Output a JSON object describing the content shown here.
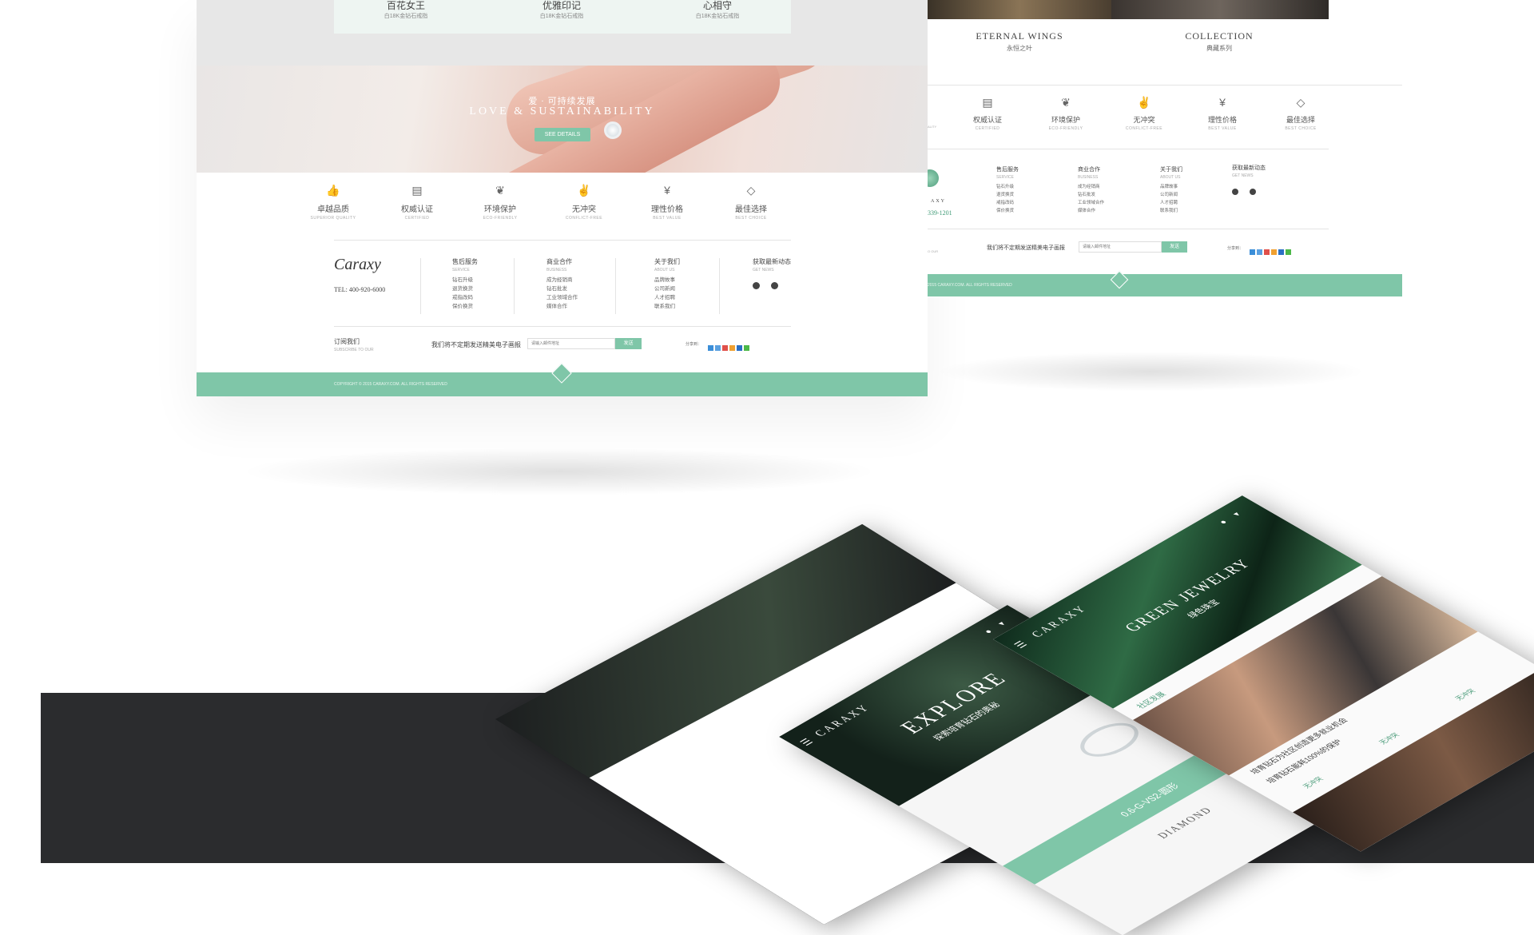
{
  "left_page": {
    "products": [
      {
        "name": "百花女王",
        "sub": "白18K金钻石戒指"
      },
      {
        "name": "优雅印记",
        "sub": "白18K金钻石戒指"
      },
      {
        "name": "心相守",
        "sub": "白18K金钻石戒指"
      }
    ],
    "hero": {
      "subtitle": "爱 · 可持续发展",
      "title": "LOVE & SUSTAINABILITY",
      "button": "SEE DETAILS"
    },
    "features": [
      {
        "icon": "thumbs-up-icon",
        "glyph": "👍",
        "label": "卓越品质",
        "en": "SUPERIOR QUALITY"
      },
      {
        "icon": "certificate-icon",
        "glyph": "▤",
        "label": "权威认证",
        "en": "CERTIFIED"
      },
      {
        "icon": "leaf-icon",
        "glyph": "❦",
        "label": "环境保护",
        "en": "ECO-FRIENDLY"
      },
      {
        "icon": "dove-icon",
        "glyph": "✌",
        "label": "无冲突",
        "en": "CONFLICT-FREE"
      },
      {
        "icon": "yen-icon",
        "glyph": "¥",
        "label": "理性价格",
        "en": "BEST VALUE"
      },
      {
        "icon": "diamond-icon",
        "glyph": "◇",
        "label": "最佳选择",
        "en": "BEST CHOICE"
      }
    ],
    "logo": "Caraxy",
    "tel": "TEL: 400-920-6000",
    "footer_cols": [
      {
        "title": "售后服务",
        "en": "SERVICE",
        "links": [
          "钻石升级",
          "退货换货",
          "戒指改码",
          "保价换货"
        ]
      },
      {
        "title": "商业合作",
        "en": "BUSINESS",
        "links": [
          "成为经销商",
          "钻石批发",
          "工业领域合作",
          "媒体合作"
        ]
      },
      {
        "title": "关于我们",
        "en": "ABOUT US",
        "links": [
          "品牌故事",
          "公司新闻",
          "人才招聘",
          "联系我们"
        ]
      },
      {
        "title": "获取最新动态",
        "en": "GET NEWS",
        "links": []
      }
    ],
    "subscribe": {
      "title": "订阅我们",
      "en": "SUBSCRIBE TO OUR",
      "text": "我们将不定期发送精美电子画报",
      "placeholder": "请输入邮件地址",
      "button": "发送",
      "share_label": "分享到："
    },
    "copyright": "COPYRIGHT © 2015 CARAXY.COM.  ALL RIGHTS RESERVED"
  },
  "right_page": {
    "collections": [
      {
        "title": "ETERNAL WINGS",
        "sub": "永恒之叶"
      },
      {
        "title": "COLLECTION",
        "sub": "典藏系列"
      }
    ],
    "features": [
      {
        "label": "权威认证",
        "en": "CERTIFIED",
        "glyph": "▤",
        "icon": "certificate-icon"
      },
      {
        "label": "环境保护",
        "en": "ECO-FRIENDLY",
        "glyph": "❦",
        "icon": "leaf-icon"
      },
      {
        "label": "无冲突",
        "en": "CONFLICT-FREE",
        "glyph": "✌",
        "icon": "dove-icon"
      },
      {
        "label": "理性价格",
        "en": "BEST VALUE",
        "glyph": "¥",
        "icon": "yen-icon"
      },
      {
        "label": "最佳选择",
        "en": "BEST CHOICE",
        "glyph": "◇",
        "icon": "diamond-icon"
      }
    ],
    "cut_feature_en": "ALITY",
    "logo_word": "AXY",
    "tel_partial": "339-1201",
    "subscribe_partial": "O OUR",
    "footer_cols": [
      {
        "title": "售后服务",
        "en": "SERVICE",
        "links": [
          "钻石升级",
          "退货换货",
          "戒指改码",
          "保价换货"
        ]
      },
      {
        "title": "商业合作",
        "en": "BUSINESS",
        "links": [
          "成为经销商",
          "钻石批发",
          "工业领域合作",
          "媒体合作"
        ]
      },
      {
        "title": "关于我们",
        "en": "ABOUT US",
        "links": [
          "品牌故事",
          "公司新闻",
          "人才招聘",
          "联系我们"
        ]
      },
      {
        "title": "获取最新动态",
        "en": "GET NEWS",
        "links": []
      }
    ],
    "subscribe_text": "我们将不定期发送精美电子画报",
    "placeholder": "请输入邮件地址",
    "button": "发送",
    "share_label": "分享到：",
    "copyright": "2015 CARAXY.COM.  ALL RIGHTS RESERVED"
  },
  "phones": {
    "brand": "CARAXY",
    "phone1_title": "EXPLORE",
    "phone1_sub": "探索培育钻石的奥秘",
    "phone1_strip": "0.6-G-VS2-圆形",
    "phone1_strip2": "DIAMOND",
    "phone2_title": "GREEN JEWELRY",
    "phone2_sub": "绿色珠宝",
    "phone2_tab": "社区发展",
    "phone2_news1": "培育钻石为社区创造更多就业机会",
    "phone2_news2": "培育钻石能耗100%的保护",
    "phone2_icon1": "无冲突",
    "phone2_icon2": "无冲突",
    "phone2_icon3": "无冲突"
  },
  "colors": {
    "accent": "#7fc6a8",
    "dark_band": "#2b2c2e",
    "top_band": "#e7e7e7"
  }
}
